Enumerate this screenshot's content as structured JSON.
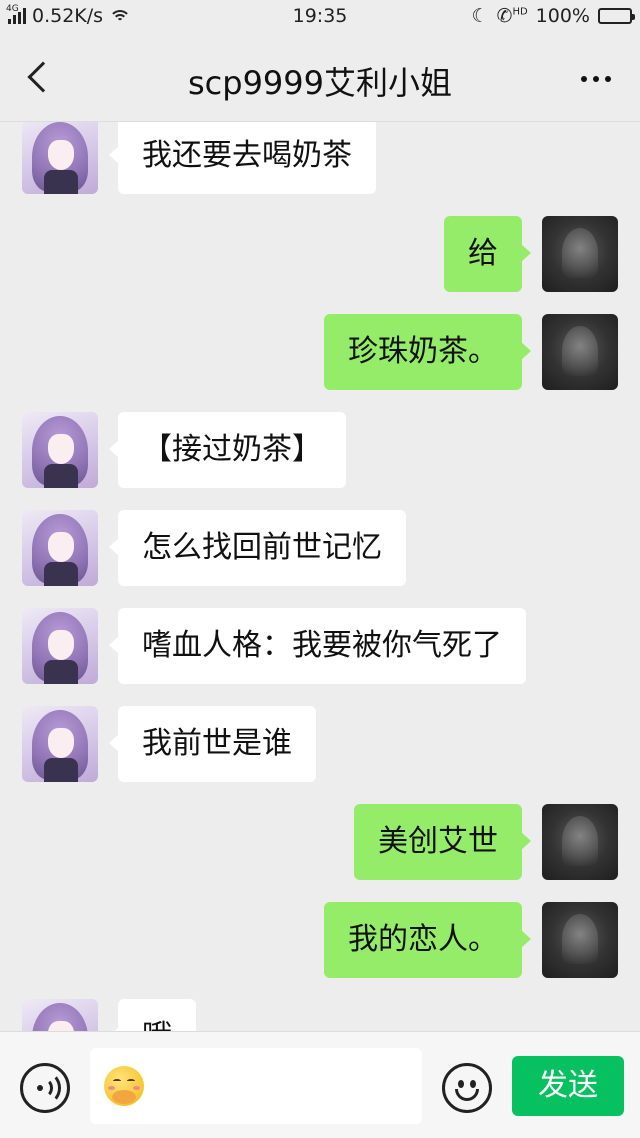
{
  "status_bar": {
    "network_type": "4G",
    "speed": "0.52K/s",
    "time": "19:35",
    "volte": "HD",
    "battery": "100%"
  },
  "header": {
    "title": "scp9999艾利小姐"
  },
  "messages": [
    {
      "side": "left",
      "text": "我还要去喝奶茶"
    },
    {
      "side": "right",
      "text": "给"
    },
    {
      "side": "right",
      "text": "珍珠奶茶。"
    },
    {
      "side": "left",
      "text": "【接过奶茶】"
    },
    {
      "side": "left",
      "text": "怎么找回前世记忆"
    },
    {
      "side": "left",
      "text": "嗜血人格：我要被你气死了"
    },
    {
      "side": "left",
      "text": "我前世是谁"
    },
    {
      "side": "right",
      "text": "美创艾世"
    },
    {
      "side": "right",
      "text": "我的恋人。"
    },
    {
      "side": "left",
      "text": "哦"
    }
  ],
  "input_bar": {
    "send_label": "发送",
    "input_emoji": "hugging-emoji"
  },
  "colors": {
    "background": "#ededed",
    "my_bubble": "#95ec69",
    "their_bubble": "#ffffff",
    "send_button": "#07c160"
  }
}
